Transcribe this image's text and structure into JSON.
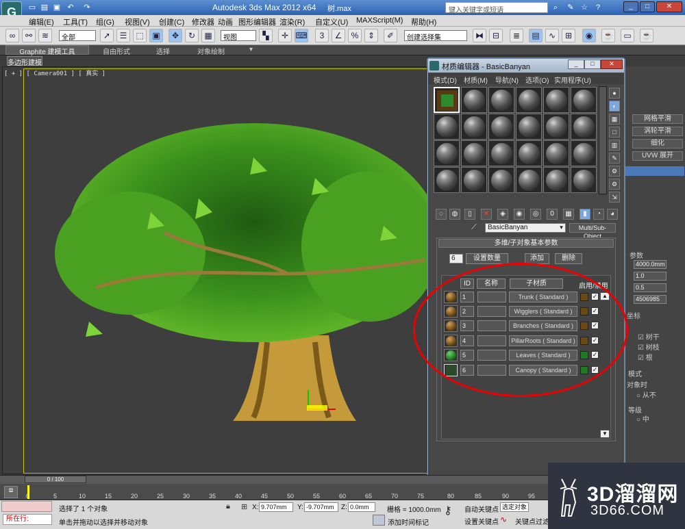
{
  "titlebar": {
    "app_title": "Autodesk 3ds Max  2012 x64",
    "file_name": "树.max",
    "search_placeholder": "键入关键字或短语"
  },
  "menubar": {
    "items": [
      "编辑(E)",
      "工具(T)",
      "组(G)",
      "视图(V)",
      "创建(C)",
      "修改器",
      "动画",
      "图形编辑器",
      "渲染(R)",
      "自定义(U)",
      "MAXScript(M)",
      "帮助(H)"
    ]
  },
  "toolbar": {
    "selection_filter": "全部",
    "coord_system": "视图",
    "named_selection": "创建选择集"
  },
  "ribbon": {
    "tabs": [
      "Graphite 建模工具",
      "自由形式",
      "选择",
      "对象绘制"
    ],
    "subtab": "多边形建模"
  },
  "viewport": {
    "label": "[ + ] [ Camera001 ] [ 真实 ]"
  },
  "material_editor": {
    "title": "材质编辑器 - BasicBanyan",
    "menu": [
      "模式(D)",
      "材质(M)",
      "导航(N)",
      "选项(O)",
      "实用程序(U)"
    ],
    "material_name": "BasicBanyan",
    "material_type": "Multi/Sub-Object",
    "rollout_title": "多维/子对象基本参数",
    "count": "6",
    "set_count_label": "设置数量",
    "add_label": "添加",
    "delete_label": "删除",
    "col_id": "ID",
    "col_name": "名称",
    "col_sub": "子材质",
    "col_enable": "启用/禁用",
    "rows": [
      {
        "id": "1",
        "sub": "Trunk  ( Standard )",
        "color": "#6b4a12"
      },
      {
        "id": "2",
        "sub": "Wigglers  ( Standard )",
        "color": "#6b4a12"
      },
      {
        "id": "3",
        "sub": "Branches  ( Standard )",
        "color": "#6b4a12"
      },
      {
        "id": "4",
        "sub": "PillarRoots  ( Standard )",
        "color": "#6b4a12"
      },
      {
        "id": "5",
        "sub": "Leaves  ( Standard )",
        "color": "#1e7a1e"
      },
      {
        "id": "6",
        "sub": "Canopy  ( Standard )",
        "color": "#1e7a1e"
      }
    ]
  },
  "command_panel": {
    "buttons": [
      "网格平滑",
      "涡轮平滑",
      "细化",
      "UVW 展开"
    ],
    "params_title": "参数",
    "height": "4000.0mm",
    "val2": "1.0",
    "val3": "0.5",
    "seed": "4506985",
    "coord_label": "坐标",
    "opt1": "树干",
    "opt2": "树枝",
    "opt3": "根",
    "mode_label": "模式",
    "mode_text": "对象时",
    "radio_never": "从不",
    "level_label": "等级",
    "radio_mid": "中"
  },
  "timeline": {
    "frame": "0 / 100",
    "ticks": [
      "0",
      "5",
      "10",
      "15",
      "20",
      "25",
      "30",
      "35",
      "40",
      "45",
      "50",
      "55",
      "60",
      "65",
      "70",
      "75",
      "80",
      "85",
      "90",
      "95"
    ]
  },
  "status": {
    "location": "所在行:",
    "selected": "选择了 1 个对象",
    "prompt": "单击并拖动以选择并移动对象",
    "x": "9.707mm",
    "y": "-9.707mm",
    "z": "0.0mm",
    "grid": "栅格 = 1000.0mm",
    "autokey": "自动关键点",
    "selected_obj": "选定对象",
    "setkey": "设置关键点",
    "keyfilter": "关键点过滤",
    "add_time_tag": "添加时间标记"
  },
  "watermark": {
    "brand": "3D溜溜网",
    "url": "3D66.COM"
  }
}
